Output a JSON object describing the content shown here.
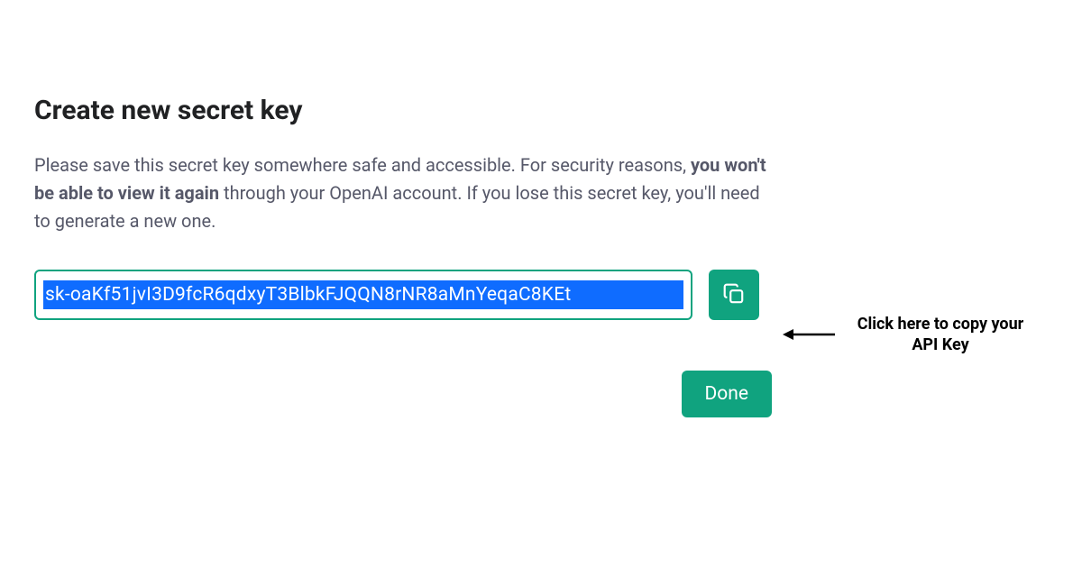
{
  "dialog": {
    "title": "Create new secret key",
    "description_pre": "Please save this secret key somewhere safe and accessible. For security reasons, ",
    "description_bold": "you won't be able to view it again",
    "description_post": " through your OpenAI account. If you lose this secret key, you'll need to generate a new one.",
    "api_key_value": "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",
    "done_label": "Done"
  },
  "annotation": {
    "text": "Click here to copy your API Key"
  },
  "colors": {
    "accent": "#10a37f",
    "selection": "#0f6cff"
  }
}
